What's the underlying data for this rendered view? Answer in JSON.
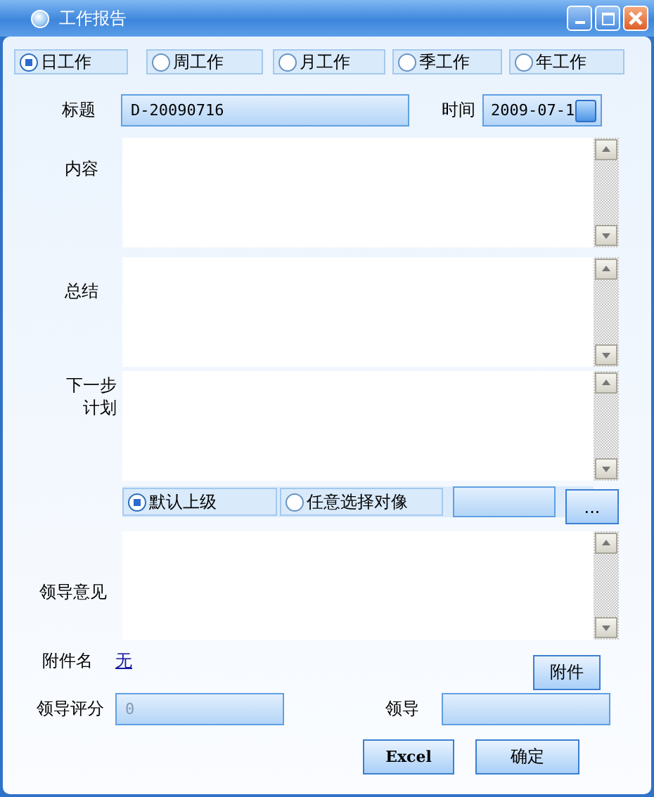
{
  "window": {
    "title": "工作报告"
  },
  "period_options": [
    {
      "label": "日工作",
      "selected": true
    },
    {
      "label": "周工作",
      "selected": false
    },
    {
      "label": "月工作",
      "selected": false
    },
    {
      "label": "季工作",
      "selected": false
    },
    {
      "label": "年工作",
      "selected": false
    }
  ],
  "title_field": {
    "label": "标题",
    "value": "D-20090716"
  },
  "time_field": {
    "label": "时间",
    "value": "2009-07-1"
  },
  "sections": [
    {
      "label": "内容"
    },
    {
      "label": "总结"
    },
    {
      "label": "下一步计划"
    }
  ],
  "recipient_options": [
    {
      "label": "默认上级",
      "selected": true
    },
    {
      "label": "任意选择对像",
      "selected": false
    }
  ],
  "browse_button": "...",
  "leader_opinion": {
    "label": "领导意见"
  },
  "attachment": {
    "label": "附件名",
    "link": "无",
    "button": "附件"
  },
  "leader_score": {
    "label": "领导评分",
    "value": "0"
  },
  "leader": {
    "label": "领导"
  },
  "buttons": [
    "Excel",
    "确定"
  ]
}
